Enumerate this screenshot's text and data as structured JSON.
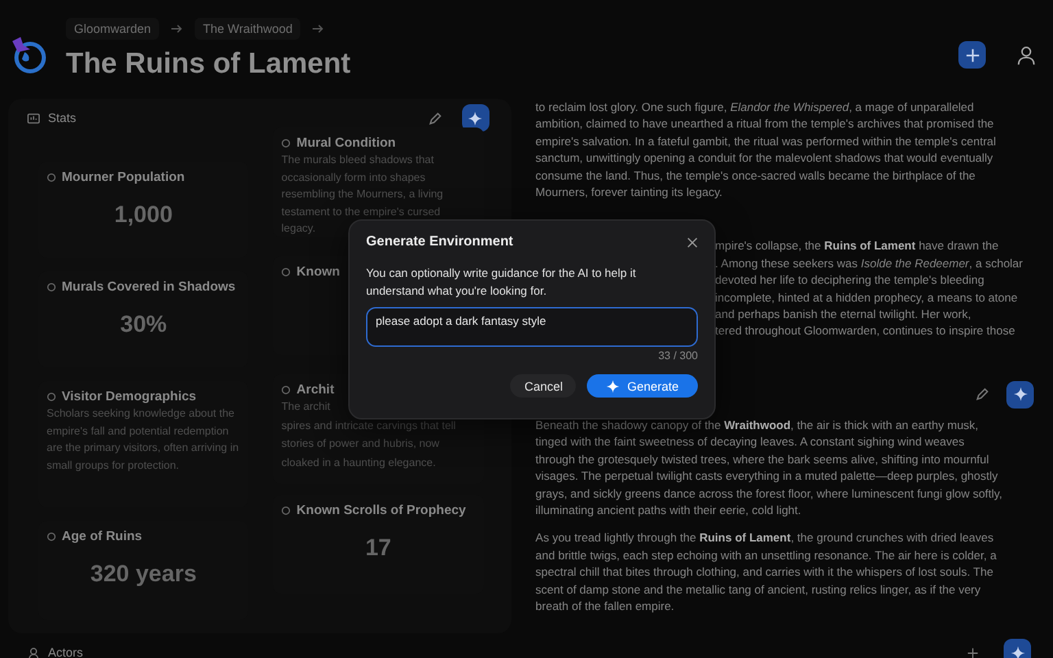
{
  "header": {
    "breadcrumbs": [
      {
        "label": "Gloomwarden"
      },
      {
        "label": "The Wraithwood"
      }
    ],
    "title": "The Ruins of Lament"
  },
  "stats": {
    "title": "Stats",
    "columns": [
      [
        {
          "kind": "number",
          "title": "Mourner Population",
          "value": "1,000"
        },
        {
          "kind": "number",
          "title": "Murals Covered in Shadows",
          "value": "30%"
        },
        {
          "kind": "text",
          "title": "Visitor Demographics",
          "lines": [
            "Scholars seeking knowledge about the empire's fall and potential redemption are the primary visitors, often arriving in small groups for protection."
          ]
        },
        {
          "kind": "number",
          "title": "Age of Ruins",
          "value": "320 years"
        }
      ],
      [
        {
          "kind": "text",
          "title": "Mural Condition",
          "lines": [
            "The murals bleed shadows that occasionally form into shapes resembling the Mourners, a living testament to the empire's cursed legacy."
          ]
        },
        {
          "kind": "text",
          "title": "Known"
        },
        {
          "kind": "text",
          "title": "Archit",
          "lines": [
            "The archit",
            "spires and intricate carvings that tell",
            "stories of power and hubris, now",
            "cloaked in a haunting elegance."
          ]
        },
        {
          "kind": "number",
          "title": "Known Scrolls of Prophecy",
          "value": "17"
        }
      ]
    ]
  },
  "sections": [
    {
      "toolbar": false,
      "paragraphs": [
        {
          "kind": "text",
          "text": "to reclaim lost glory. One such figure, *Elandor the Whispered*, a mage of unparalleled ambition, claimed to have unearthed a ritual from the temple's archives that promised the empire's salvation. In a fateful gambit, the ritual was performed within the temple's central sanctum, unwittingly opening a conduit for the malevolent shadows that would eventually consume the land. Thus, the temple's once-sacred walls became the birthplace of the Mourners, forever tainting its legacy."
        },
        {
          "kind": "fragments",
          "lines": [
            "mpire's collapse, the **Ruins of Lament** have drawn the",
            ". Among these seekers was *Isolde the Redeemer*, a scholar",
            "devoted her life to deciphering the temple's bleeding",
            "incomplete, hinted at a hidden prophecy, a means to atone",
            "and perhaps banish the eternal twilight. Her work,",
            "tered throughout Gloomwarden, continues to inspire those"
          ]
        }
      ]
    },
    {
      "toolbar": true,
      "paragraphs": [
        {
          "kind": "text",
          "text": "Beneath the shadowy canopy of the **Wraithwood**, the air is thick with an earthy musk, tinged with the faint sweetness of decaying leaves. A constant sighing wind weaves through the grotesquely twisted trees, where the bark seems alive, shifting into mournful visages. The perpetual twilight casts everything in a muted palette—deep purples, ghostly grays, and sickly greens dance across the forest floor, where luminescent fungi glow softly, illuminating ancient paths with their eerie, cold light."
        },
        {
          "kind": "text",
          "text": "As you tread lightly through the **Ruins of Lament**, the ground crunches with dried leaves and brittle twigs, each step echoing with an unsettling resonance. The air here is colder, a spectral chill that bites through clothing, and carries with it the whispers of lost souls. The scent of damp stone and the metallic tang of ancient, rusting relics linger, as if the very breath of the fallen empire."
        }
      ]
    }
  ],
  "actors": {
    "title": "Actors"
  },
  "dialog": {
    "title": "Generate Environment",
    "description": "You can optionally write guidance for the AI to help it understand what you're looking for.",
    "value": "please adopt a dark fantasy style",
    "counter": "33 / 300",
    "buttons": [
      {
        "label": "Cancel",
        "kind": "secondary"
      },
      {
        "label": "Generate",
        "kind": "primary"
      }
    ]
  }
}
